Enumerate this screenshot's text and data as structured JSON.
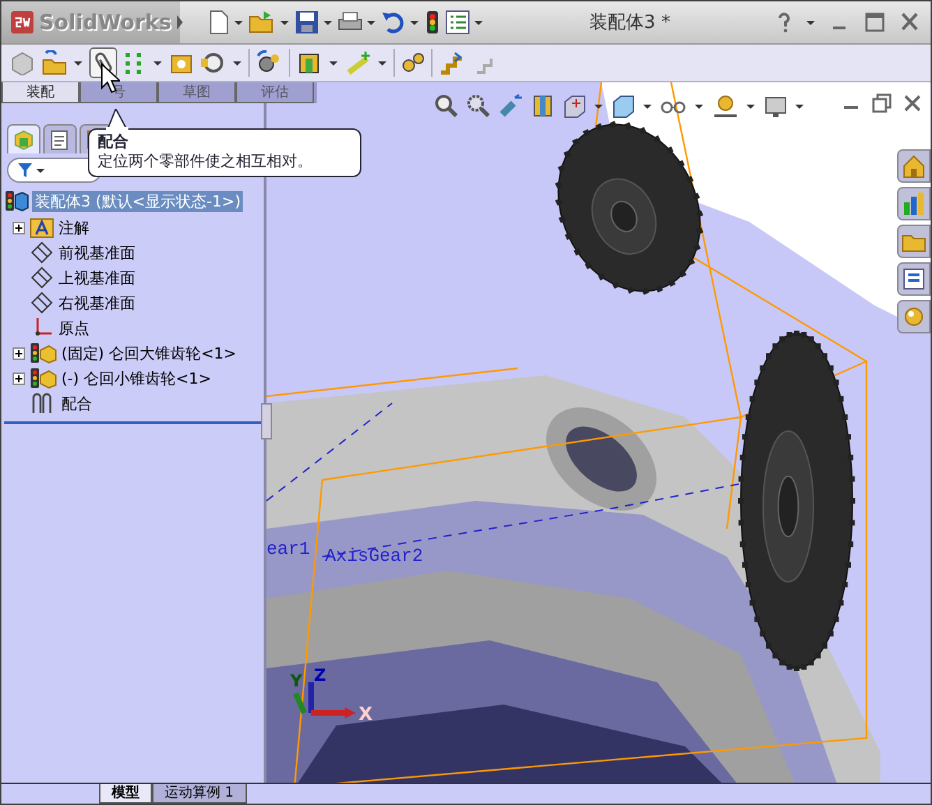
{
  "app": {
    "name": "SolidWorks",
    "document_title": "装配体3 *"
  },
  "command_tabs": [
    {
      "label": "装配",
      "selected": true
    },
    {
      "label": "号",
      "selected": false
    },
    {
      "label": "草图",
      "selected": false
    },
    {
      "label": "评估",
      "selected": false
    }
  ],
  "tooltip": {
    "title": "配合",
    "description": "定位两个零部件使之相互相对。"
  },
  "panel_tabs": [
    {
      "kind": "feature_tree",
      "selected": true
    },
    {
      "kind": "property",
      "selected": false
    },
    {
      "kind": "configuration",
      "selected": false
    }
  ],
  "tree": {
    "label": "装配体3 (默认<显示状态-1>)",
    "selected": true,
    "children": [
      {
        "kind": "annotations",
        "label": "注解",
        "expandable": true
      },
      {
        "kind": "plane",
        "label": "前视基准面",
        "expandable": false
      },
      {
        "kind": "plane",
        "label": "上视基准面",
        "expandable": false
      },
      {
        "kind": "plane",
        "label": "右视基准面",
        "expandable": false
      },
      {
        "kind": "origin",
        "label": "原点",
        "expandable": false
      },
      {
        "kind": "part",
        "label": "(固定) 仑回大锥齿轮<1>",
        "expandable": true
      },
      {
        "kind": "part",
        "label": "(-) 仑回小锥齿轮<1>",
        "expandable": true
      },
      {
        "kind": "mates",
        "label": "配合",
        "expandable": false
      }
    ]
  },
  "viewport": {
    "axis_labels": [
      "ear1",
      "AxisGear2"
    ],
    "triad": {
      "x": "X",
      "y": "Y",
      "z": "Z"
    }
  },
  "bottom_tabs": [
    {
      "label": "模型",
      "selected": true
    },
    {
      "label": "运动算例 1",
      "selected": false
    }
  ]
}
